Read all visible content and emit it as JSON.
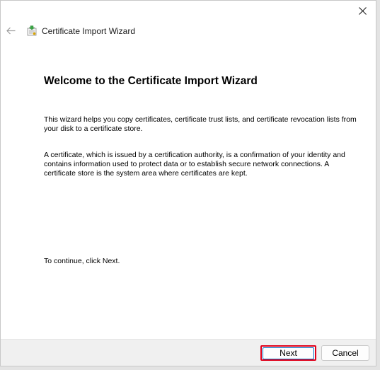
{
  "window": {
    "close_icon": "close-icon"
  },
  "titlebar": {
    "back_icon": "back-arrow-icon",
    "app_icon": "certificate-wizard-icon",
    "title": "Certificate Import Wizard"
  },
  "content": {
    "heading": "Welcome to the Certificate Import Wizard",
    "paragraph1": "This wizard helps you copy certificates, certificate trust lists, and certificate revocation lists from your disk to a certificate store.",
    "paragraph2": "A certificate, which is issued by a certification authority, is a confirmation of your identity and contains information used to protect data or to establish secure network connections. A certificate store is the system area where certificates are kept.",
    "paragraph3": "To continue, click Next."
  },
  "footer": {
    "next_label": "Next",
    "cancel_label": "Cancel"
  },
  "colors": {
    "highlight": "#e0001a",
    "focus_ring": "#0067c0",
    "footer_bg": "#f0f0f0"
  }
}
